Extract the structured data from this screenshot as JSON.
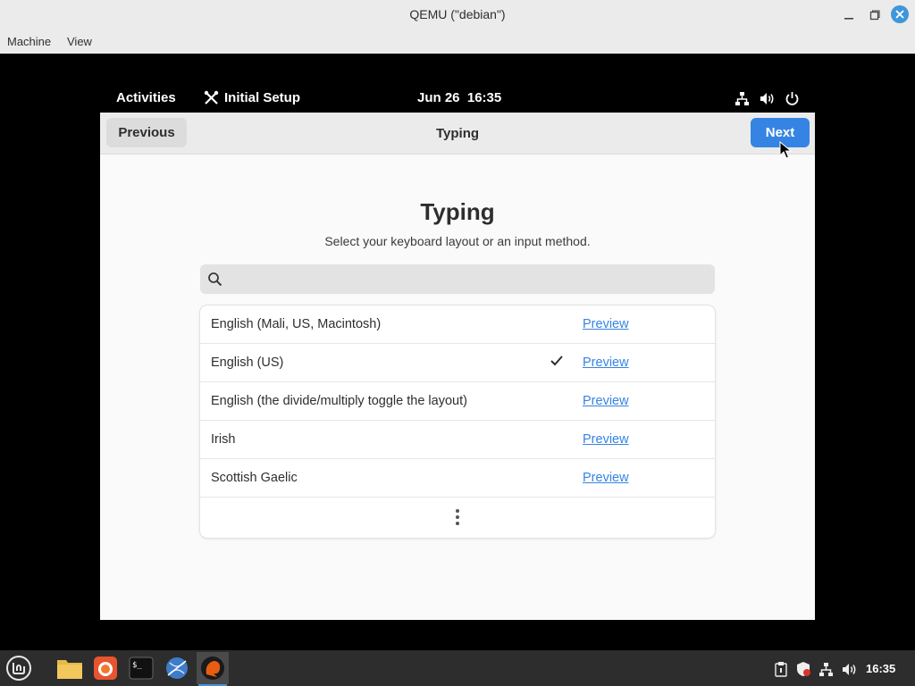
{
  "window": {
    "title": "QEMU (\"debian\")"
  },
  "menubar": {
    "items": [
      "Machine",
      "View"
    ]
  },
  "gnome_bar": {
    "activities": "Activities",
    "app_name": "Initial Setup",
    "clock": "Jun 26  16:35"
  },
  "header": {
    "previous_label": "Previous",
    "title": "Typing",
    "next_label": "Next"
  },
  "page": {
    "heading": "Typing",
    "subtitle": "Select your keyboard layout or an input method."
  },
  "search": {
    "value": "",
    "placeholder": ""
  },
  "layouts": [
    {
      "name": "English (Mali, US, Macintosh)",
      "selected": false,
      "preview": "Preview"
    },
    {
      "name": "English (US)",
      "selected": true,
      "preview": "Preview"
    },
    {
      "name": "English (the divide/multiply toggle the layout)",
      "selected": false,
      "preview": "Preview"
    },
    {
      "name": "Irish",
      "selected": false,
      "preview": "Preview"
    },
    {
      "name": "Scottish Gaelic",
      "selected": false,
      "preview": "Preview"
    }
  ],
  "taskbar": {
    "clock": "16:35"
  },
  "colors": {
    "accent": "#3584e4",
    "close": "#3e97d9",
    "taskbar": "#2d2d2d"
  }
}
